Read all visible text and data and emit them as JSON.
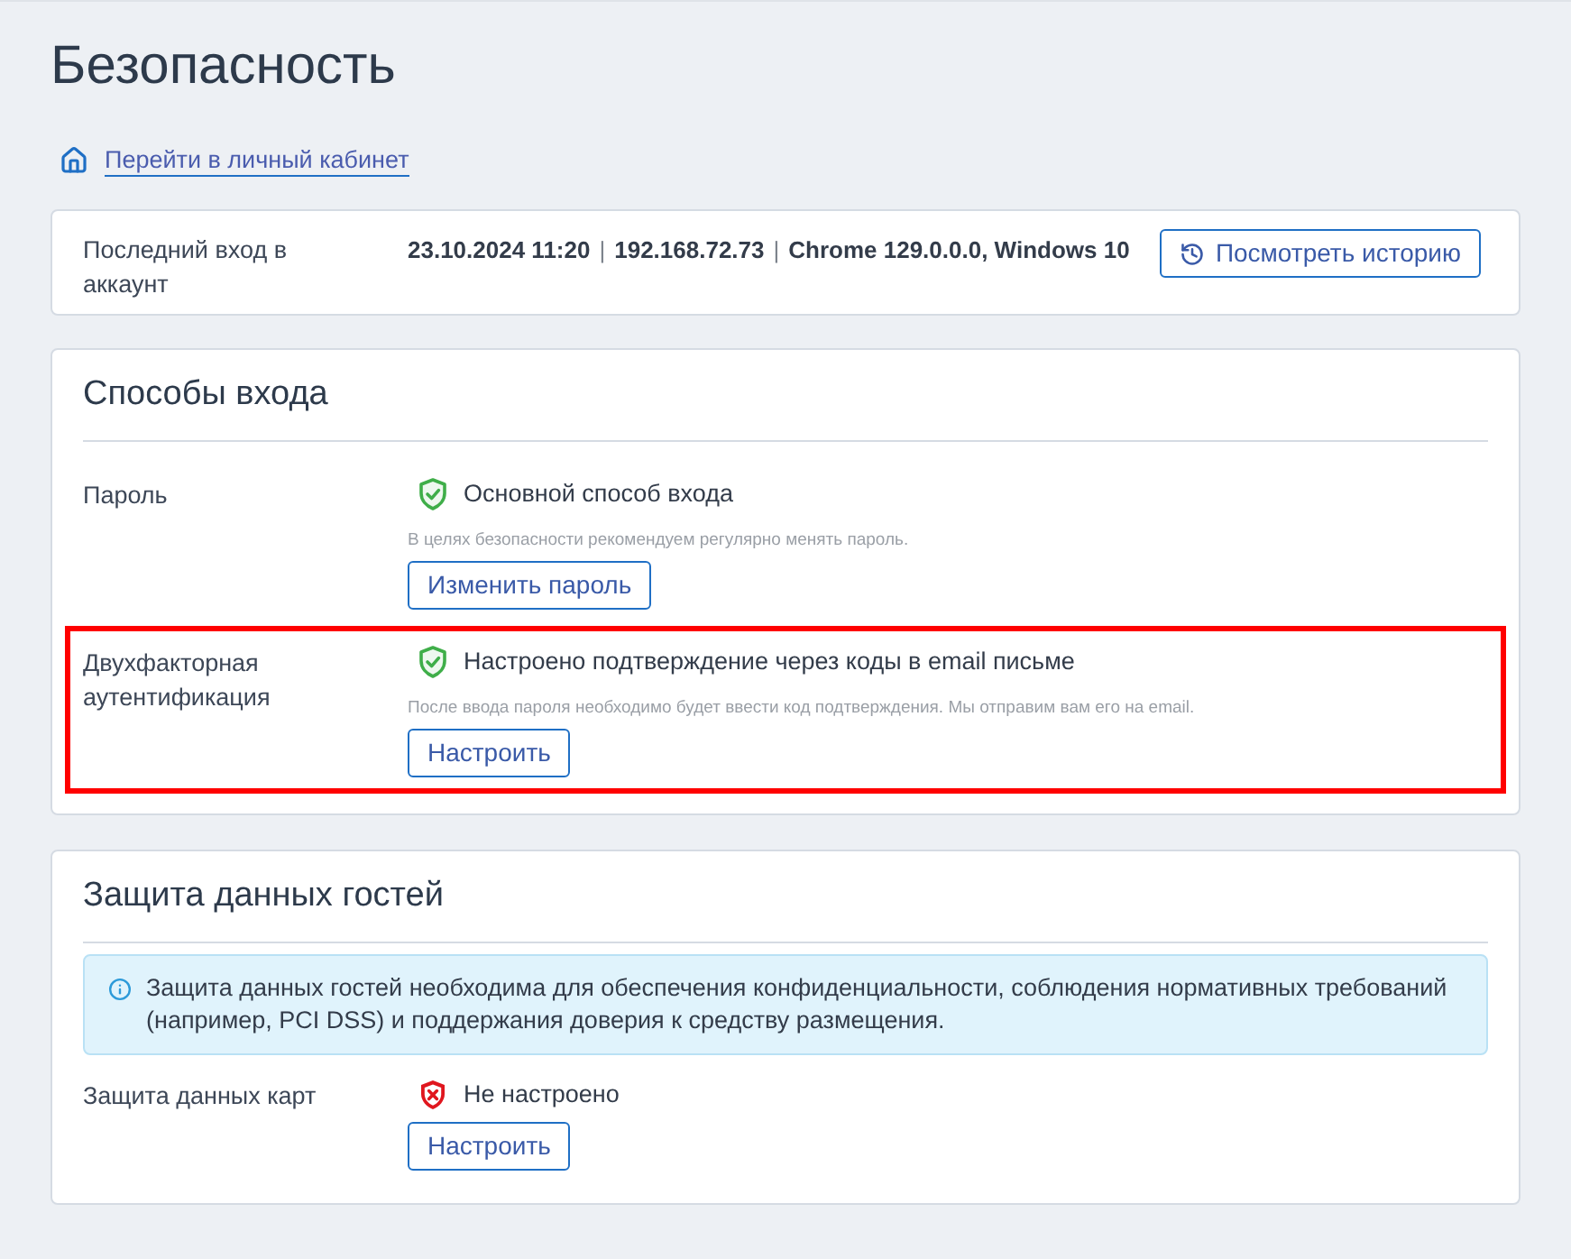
{
  "page": {
    "title": "Безопасность",
    "home_link": "Перейти в личный кабинет"
  },
  "last_login": {
    "label": "Последний вход в аккаунт",
    "details": [
      {
        "kind": "value",
        "text": "23.10.2024 11:20"
      },
      {
        "kind": "separator",
        "text": "|"
      },
      {
        "kind": "value",
        "text": "192.168.72.73"
      },
      {
        "kind": "separator",
        "text": "|"
      },
      {
        "kind": "value",
        "text": "Chrome 129.0.0.0, Windows 10"
      }
    ],
    "button": "Посмотреть историю"
  },
  "login_methods": {
    "title": "Способы входа",
    "rows": [
      {
        "label": "Пароль",
        "kind": "ok",
        "status_text": "Основной способ входа",
        "hint": "В целях безопасности рекомендуем регулярно менять пароль.",
        "button": "Изменить пароль",
        "highlighted": false
      },
      {
        "label": "Двухфакторная аутентификация",
        "kind": "ok",
        "status_text": "Настроено подтверждение через коды в email письме",
        "hint": "После ввода пароля необходимо будет ввести код подтверждения. Мы отправим вам его на email.",
        "button": "Настроить",
        "highlighted": true
      }
    ]
  },
  "guest_protection": {
    "title": "Защита данных гостей",
    "notice": "Защита данных гостей необходима для обеспечения конфиденциальности, соблюдения нормативных требований (например, PCI DSS) и поддержания доверия к средству размещения.",
    "rows": [
      {
        "label": "Защита данных карт",
        "kind": "error",
        "status_text": "Не настроено",
        "button": "Настроить",
        "highlighted": false
      }
    ]
  }
}
